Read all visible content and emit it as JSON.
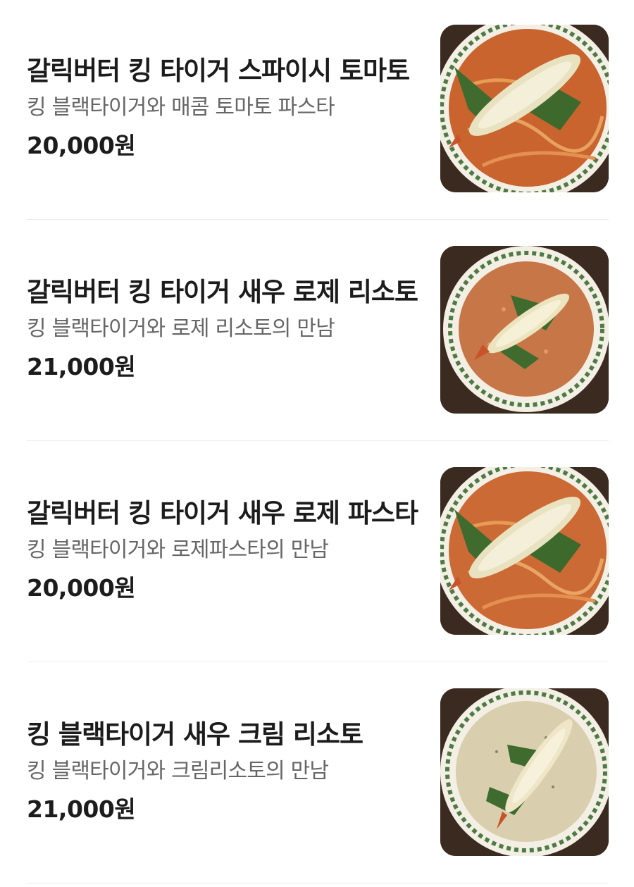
{
  "menu": {
    "items": [
      {
        "name": "갈릭버터 킹 타이거 스파이시 토마토",
        "description": "킹 블랙타이거와 매콤 토마토 파스타",
        "price": "20,000원",
        "image": "pasta-dish-photo",
        "sauce_color": "#c9642f"
      },
      {
        "name": "갈릭버터 킹 타이거 새우 로제 리소토",
        "description": "킹 블랙타이거와 로제 리소토의 만남",
        "price": "21,000원",
        "image": "risotto-dish-photo",
        "sauce_color": "#c77747"
      },
      {
        "name": "갈릭버터 킹 타이거 새우 로제 파스타",
        "description": "킹 블랙타이거와 로제파스타의 만남",
        "price": "20,000원",
        "image": "pasta-dish-photo",
        "sauce_color": "#cc6a35"
      },
      {
        "name": "킹 블랙타이거 새우 크림 리소토",
        "description": "킹 블랙타이거와 크림리소토의 만남",
        "price": "21,000원",
        "image": "cream-risotto-dish-photo",
        "sauce_color": "#d9cfae"
      }
    ]
  }
}
